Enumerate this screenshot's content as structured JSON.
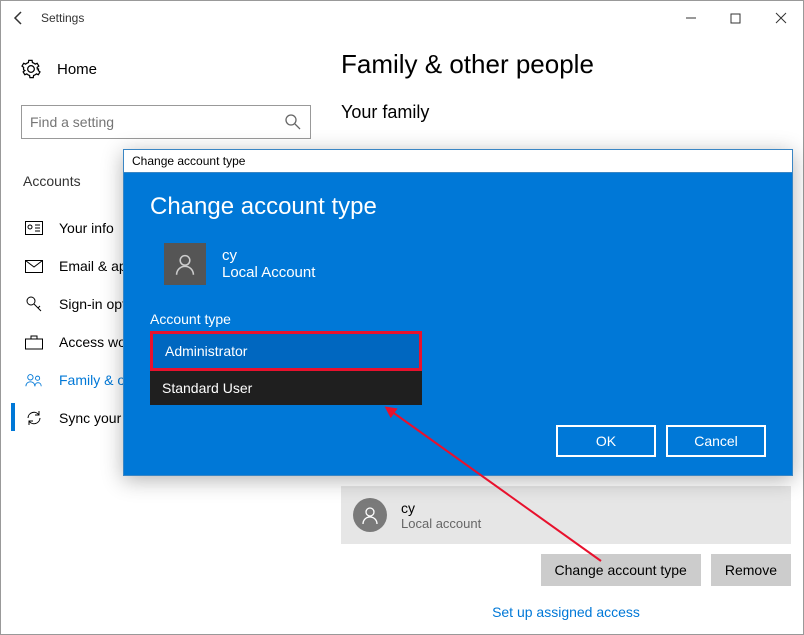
{
  "window": {
    "title": "Settings"
  },
  "home": {
    "label": "Home"
  },
  "search": {
    "placeholder": "Find a setting"
  },
  "nav": {
    "header": "Accounts",
    "items": [
      {
        "label": "Your info"
      },
      {
        "label": "Email & app accounts"
      },
      {
        "label": "Sign-in options"
      },
      {
        "label": "Access work or school"
      },
      {
        "label": "Family & other people"
      },
      {
        "label": "Sync your settings"
      }
    ]
  },
  "content": {
    "page_title": "Family & other people",
    "section_title": "Your family",
    "user": {
      "name": "cy",
      "sub": "Local account"
    },
    "btn_change": "Change account type",
    "btn_remove": "Remove",
    "link_setup": "Set up assigned access"
  },
  "dialog": {
    "titlebar": "Change account type",
    "heading": "Change account type",
    "user": {
      "name": "cy",
      "sub": "Local Account"
    },
    "label": "Account type",
    "options": {
      "selected": "Administrator",
      "other": "Standard User"
    },
    "ok": "OK",
    "cancel": "Cancel"
  }
}
